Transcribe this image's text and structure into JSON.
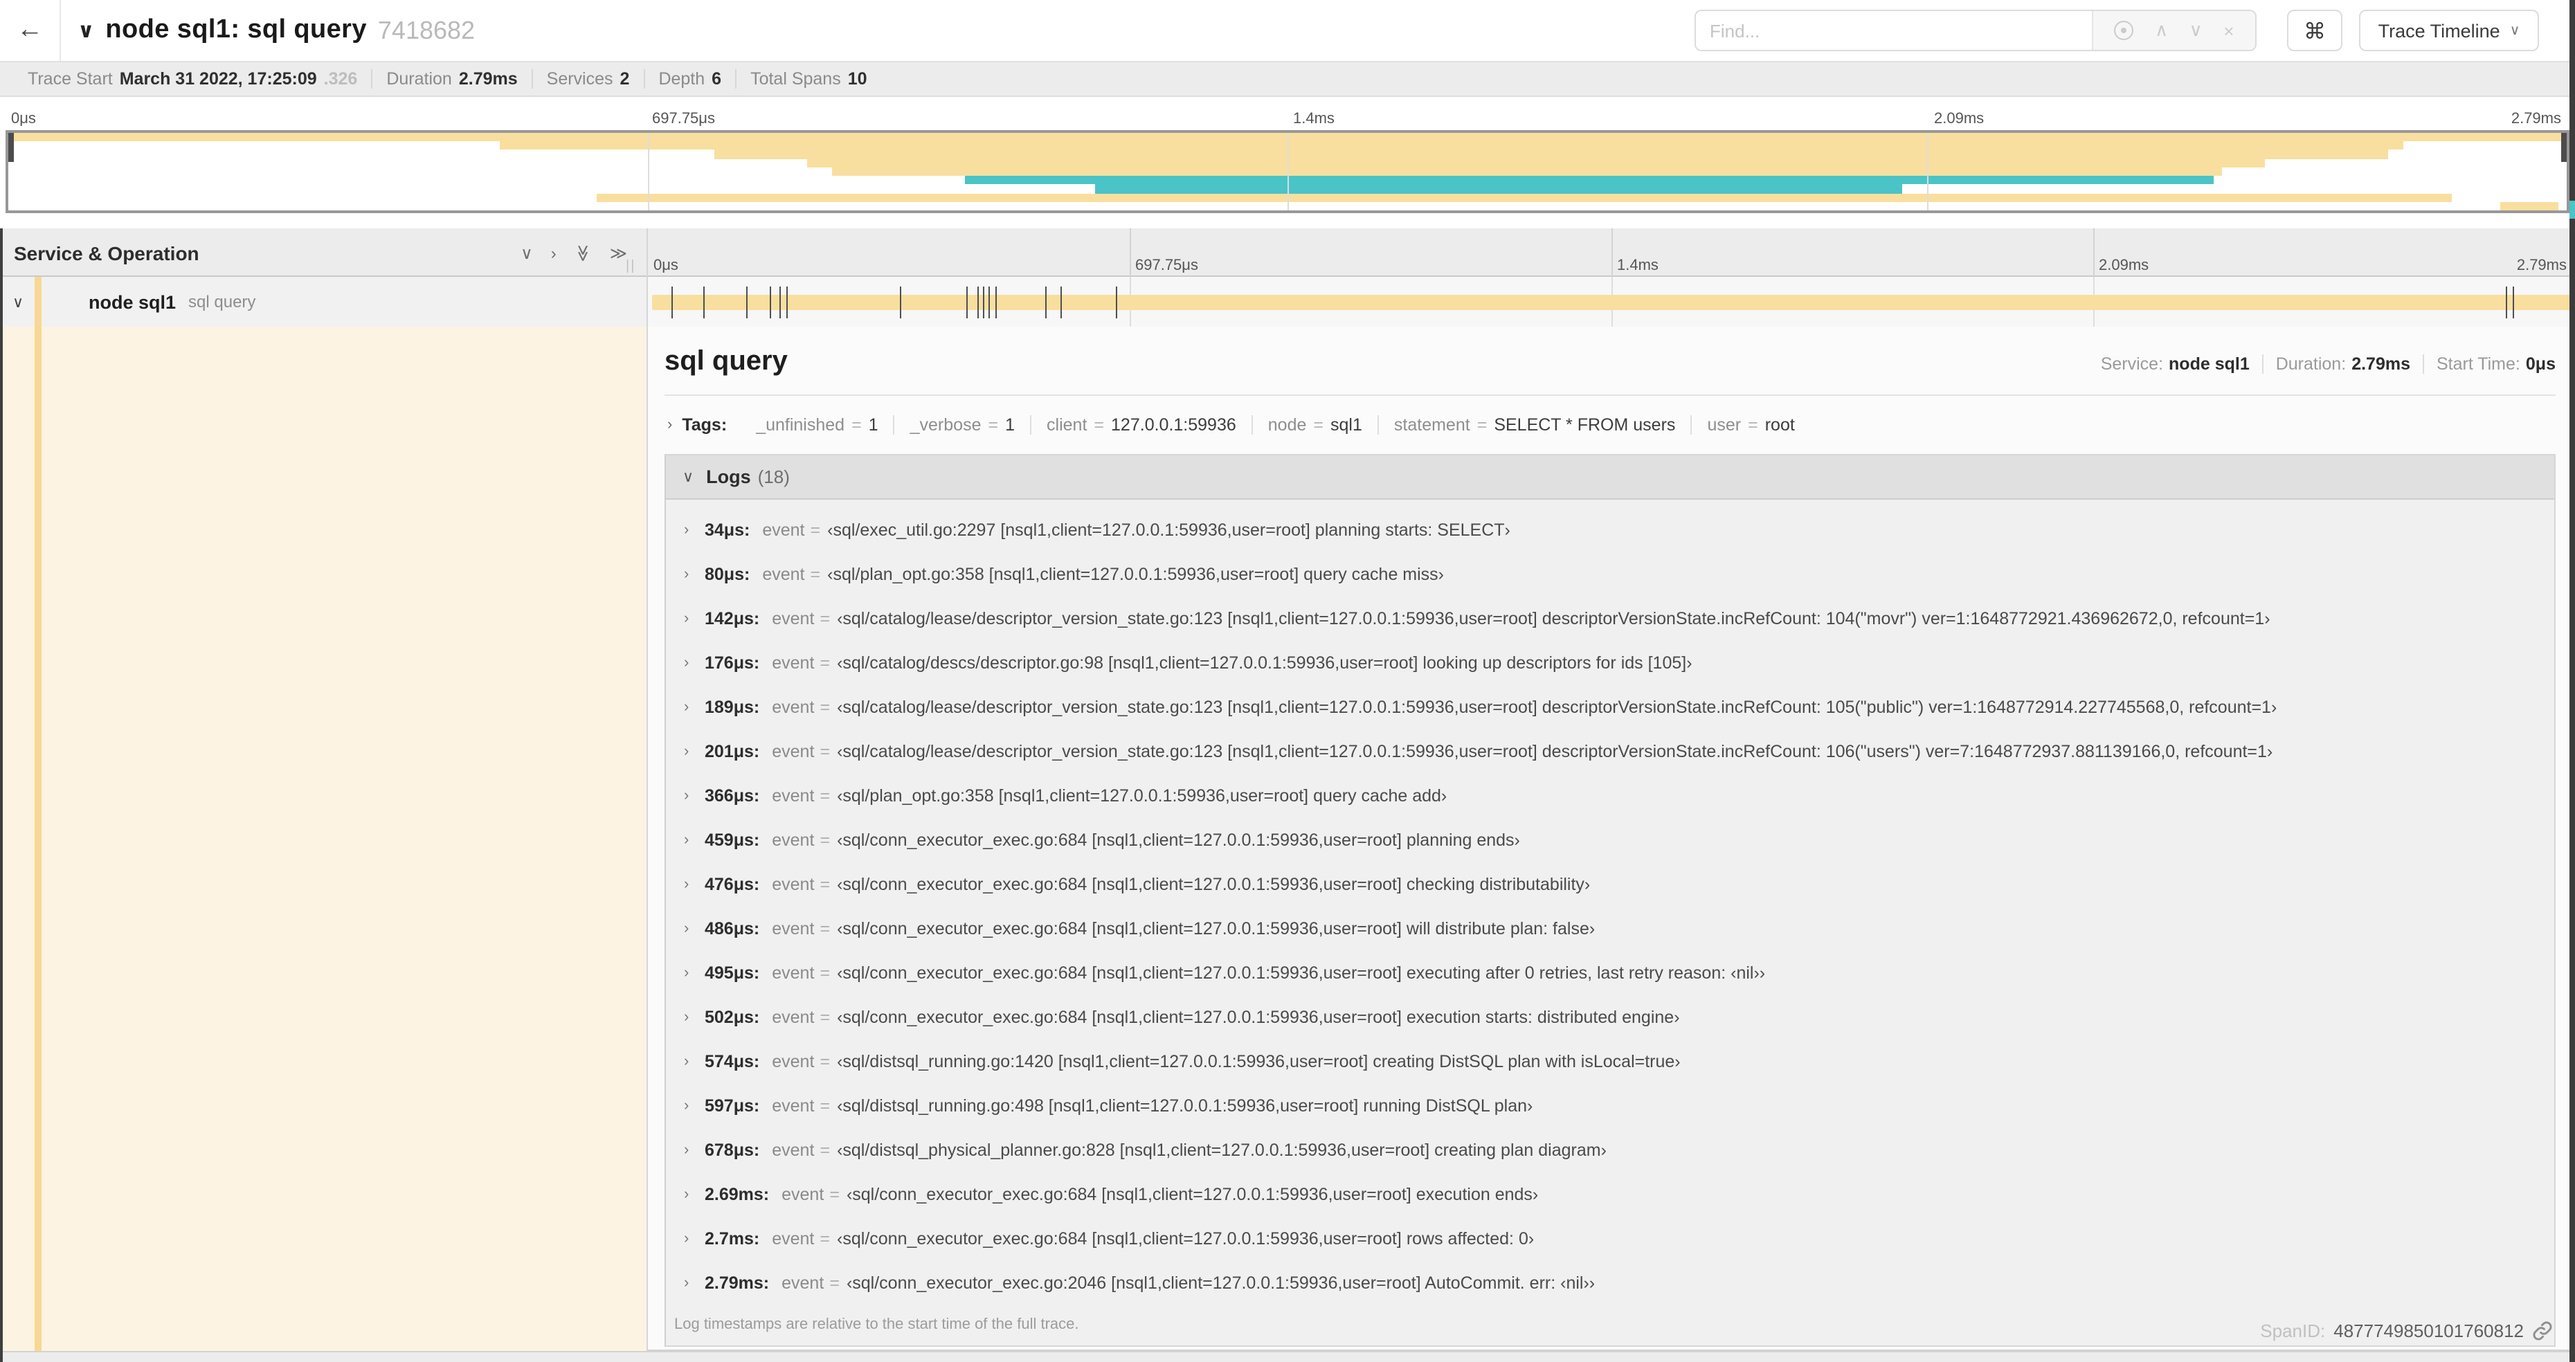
{
  "header": {
    "back_label": "←",
    "title_chevron": "∨",
    "title": "node sql1: sql query",
    "trace_id": "7418682",
    "find_placeholder": "Find...",
    "prev_label": "∧",
    "next_label": "∨",
    "clear_label": "×",
    "shortcut_label": "⌘",
    "view_dropdown": "Trace Timeline",
    "view_dropdown_chevron": "∨"
  },
  "stats": [
    {
      "label": "Trace Start",
      "value": "March 31 2022, 17:25:09",
      "suffix": ".326"
    },
    {
      "label": "Duration",
      "value": "2.79ms",
      "suffix": ""
    },
    {
      "label": "Services",
      "value": "2",
      "suffix": ""
    },
    {
      "label": "Depth",
      "value": "6",
      "suffix": ""
    },
    {
      "label": "Total Spans",
      "value": "10",
      "suffix": ""
    }
  ],
  "minimap": {
    "ticks": [
      "0μs",
      "697.75μs",
      "1.4ms",
      "2.09ms",
      "2.79ms"
    ],
    "grid_pcts": [
      25,
      50,
      75
    ],
    "rows": [
      {
        "color": "tan",
        "left": 0,
        "width": 100
      },
      {
        "color": "tan",
        "left": 19.2,
        "width": 74.4
      },
      {
        "color": "tan",
        "left": 27.6,
        "width": 65.4
      },
      {
        "color": "tan",
        "left": 31.2,
        "width": 57.0
      },
      {
        "color": "tan",
        "left": 32.2,
        "width": 54.3
      },
      {
        "color": "teal",
        "left": 37.4,
        "width": 48.8
      },
      {
        "color": "teal",
        "left": 42.5,
        "width": 31.5
      },
      {
        "color": "tan",
        "left": 23.0,
        "width": 72.5
      },
      {
        "color": "tan",
        "left": 97.4,
        "width": 2.3
      }
    ]
  },
  "timeline": {
    "section_header": "Service & Operation",
    "collapse_icons": [
      "∨",
      "›",
      "≫",
      "≫"
    ],
    "resizer_glyph": "||",
    "ticks": [
      "0μs",
      "697.75μs",
      "1.4ms",
      "2.09ms",
      "2.79ms"
    ],
    "grid_pcts": [
      25,
      50,
      75
    ],
    "row": {
      "chevron": "∨",
      "service": "node sql1",
      "operation": "sql query",
      "bar_left_pct": 0.2,
      "bar_width_pct": 99.6,
      "log_marker_pcts": [
        1.2,
        2.9,
        5.1,
        6.3,
        6.8,
        7.2,
        13.1,
        16.5,
        17.1,
        17.4,
        17.7,
        18.0,
        20.6,
        21.4,
        24.3,
        96.4,
        96.8,
        99.8
      ]
    }
  },
  "detail": {
    "title": "sql query",
    "meta": [
      {
        "label": "Service:",
        "value": "node sql1"
      },
      {
        "label": "Duration:",
        "value": "2.79ms"
      },
      {
        "label": "Start Time:",
        "value": "0μs"
      }
    ],
    "tags_toggle": "›",
    "tags_label": "Tags:",
    "tags": [
      {
        "key": "_unfinished",
        "value": "1"
      },
      {
        "key": "_verbose",
        "value": "1"
      },
      {
        "key": "client",
        "value": "127.0.0.1:59936"
      },
      {
        "key": "node",
        "value": "sql1"
      },
      {
        "key": "statement",
        "value": "SELECT * FROM users"
      },
      {
        "key": "user",
        "value": "root"
      }
    ],
    "logs_chevron": "∨",
    "logs_label": "Logs",
    "logs_count": "(18)",
    "log_key": "event",
    "logs": [
      {
        "time": "34μs:",
        "value": "‹sql/exec_util.go:2297 [nsql1,client=127.0.0.1:59936,user=root] planning starts: SELECT›"
      },
      {
        "time": "80μs:",
        "value": "‹sql/plan_opt.go:358 [nsql1,client=127.0.0.1:59936,user=root] query cache miss›"
      },
      {
        "time": "142μs:",
        "value": "‹sql/catalog/lease/descriptor_version_state.go:123 [nsql1,client=127.0.0.1:59936,user=root] descriptorVersionState.incRefCount: 104(\"movr\") ver=1:1648772921.436962672,0, refcount=1›"
      },
      {
        "time": "176μs:",
        "value": "‹sql/catalog/descs/descriptor.go:98 [nsql1,client=127.0.0.1:59936,user=root] looking up descriptors for ids [105]›"
      },
      {
        "time": "189μs:",
        "value": "‹sql/catalog/lease/descriptor_version_state.go:123 [nsql1,client=127.0.0.1:59936,user=root] descriptorVersionState.incRefCount: 105(\"public\") ver=1:1648772914.227745568,0, refcount=1›"
      },
      {
        "time": "201μs:",
        "value": "‹sql/catalog/lease/descriptor_version_state.go:123 [nsql1,client=127.0.0.1:59936,user=root] descriptorVersionState.incRefCount: 106(\"users\") ver=7:1648772937.881139166,0, refcount=1›"
      },
      {
        "time": "366μs:",
        "value": "‹sql/plan_opt.go:358 [nsql1,client=127.0.0.1:59936,user=root] query cache add›"
      },
      {
        "time": "459μs:",
        "value": "‹sql/conn_executor_exec.go:684 [nsql1,client=127.0.0.1:59936,user=root] planning ends›"
      },
      {
        "time": "476μs:",
        "value": "‹sql/conn_executor_exec.go:684 [nsql1,client=127.0.0.1:59936,user=root] checking distributability›"
      },
      {
        "time": "486μs:",
        "value": "‹sql/conn_executor_exec.go:684 [nsql1,client=127.0.0.1:59936,user=root] will distribute plan: false›"
      },
      {
        "time": "495μs:",
        "value": "‹sql/conn_executor_exec.go:684 [nsql1,client=127.0.0.1:59936,user=root] executing after 0 retries, last retry reason: ‹nil››"
      },
      {
        "time": "502μs:",
        "value": "‹sql/conn_executor_exec.go:684 [nsql1,client=127.0.0.1:59936,user=root] execution starts: distributed engine›"
      },
      {
        "time": "574μs:",
        "value": "‹sql/distsql_running.go:1420 [nsql1,client=127.0.0.1:59936,user=root] creating DistSQL plan with isLocal=true›"
      },
      {
        "time": "597μs:",
        "value": "‹sql/distsql_running.go:498 [nsql1,client=127.0.0.1:59936,user=root] running DistSQL plan›"
      },
      {
        "time": "678μs:",
        "value": "‹sql/distsql_physical_planner.go:828 [nsql1,client=127.0.0.1:59936,user=root] creating plan diagram›"
      },
      {
        "time": "2.69ms:",
        "value": "‹sql/conn_executor_exec.go:684 [nsql1,client=127.0.0.1:59936,user=root] execution ends›"
      },
      {
        "time": "2.7ms:",
        "value": "‹sql/conn_executor_exec.go:684 [nsql1,client=127.0.0.1:59936,user=root] rows affected: 0›"
      },
      {
        "time": "2.79ms:",
        "value": "‹sql/conn_executor_exec.go:2046 [nsql1,client=127.0.0.1:59936,user=root] AutoCommit. err: ‹nil››"
      }
    ],
    "footnote": "Log timestamps are relative to the start time of the full trace.",
    "spanid_label": "SpanID:",
    "spanid": "4877749850101760812"
  },
  "colors": {
    "tan": "#f8df9f",
    "teal": "#4ac4c6",
    "amber_strip": "#f7d895",
    "cream": "#fdf3e3"
  }
}
